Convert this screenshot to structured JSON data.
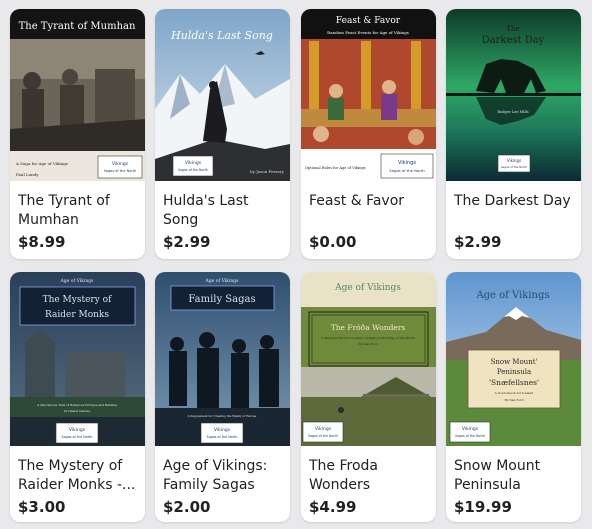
{
  "products": [
    {
      "title": "The Tyrant of Mumhan",
      "price": "$8.99",
      "cover": {
        "headline": "The Tyrant of Mumhan",
        "subtitle": "A Saga for Age of Vikings",
        "author": "Paul Landy"
      }
    },
    {
      "title": "Hulda's Last Song",
      "price": "$2.99",
      "cover": {
        "headline": "Hulda's Last Song",
        "author": "by Jason Ferrary"
      }
    },
    {
      "title": "Feast & Favor",
      "price": "$0.00",
      "cover": {
        "headline": "Feast & Favor",
        "subtitle": "Random Feast Events for Age of Vikings",
        "footer": "Optional Rules for Age of Vikings"
      }
    },
    {
      "title": "The Darkest Day",
      "price": "$2.99",
      "cover": {
        "headline_line1": "The",
        "headline_line2": "Darkest Day",
        "author": "Rodger Lee Mills"
      }
    },
    {
      "title": "The Mystery of Raider Monks -...",
      "price": "$3.00",
      "cover": {
        "series": "Age of Vikings",
        "headline_line1": "The Mystery of",
        "headline_line2": "Raider Monks",
        "footer": "A Murderous Trail of Religious Intrigue and Raiding",
        "author": "by Daniel Galway"
      }
    },
    {
      "title": "Age of Vikings: Family Sagas",
      "price": "$2.00",
      "cover": {
        "series": "Age of Vikings",
        "headline": "Family Sagas",
        "footer": "A Supplement for Creating the Family of Heroes"
      }
    },
    {
      "title": "The Froda Wonders",
      "price": "$4.99",
      "cover": {
        "series": "Age of Vikings",
        "headline": "The Fróða Wonders",
        "tagline": "A Haunted Farm in Iceland, Caught on the Edge of the World",
        "author": "By Dan Ford"
      }
    },
    {
      "title": "Snow Mount Peninsula",
      "price": "$19.99",
      "cover": {
        "series": "Age of Vikings",
        "headline_line1": "Snow Mount'",
        "headline_line2": "Peninsula",
        "headline_line3": "'Snæfellsnes'",
        "tagline": "A Sourcebook for Iceland",
        "author": "By Dan Ford"
      }
    }
  ],
  "badge": {
    "line1": "Vikings",
    "line2": "Sagas of the North"
  },
  "colors": {
    "background": "#e9e9eb",
    "card": "#ffffff",
    "text": "#202124"
  }
}
